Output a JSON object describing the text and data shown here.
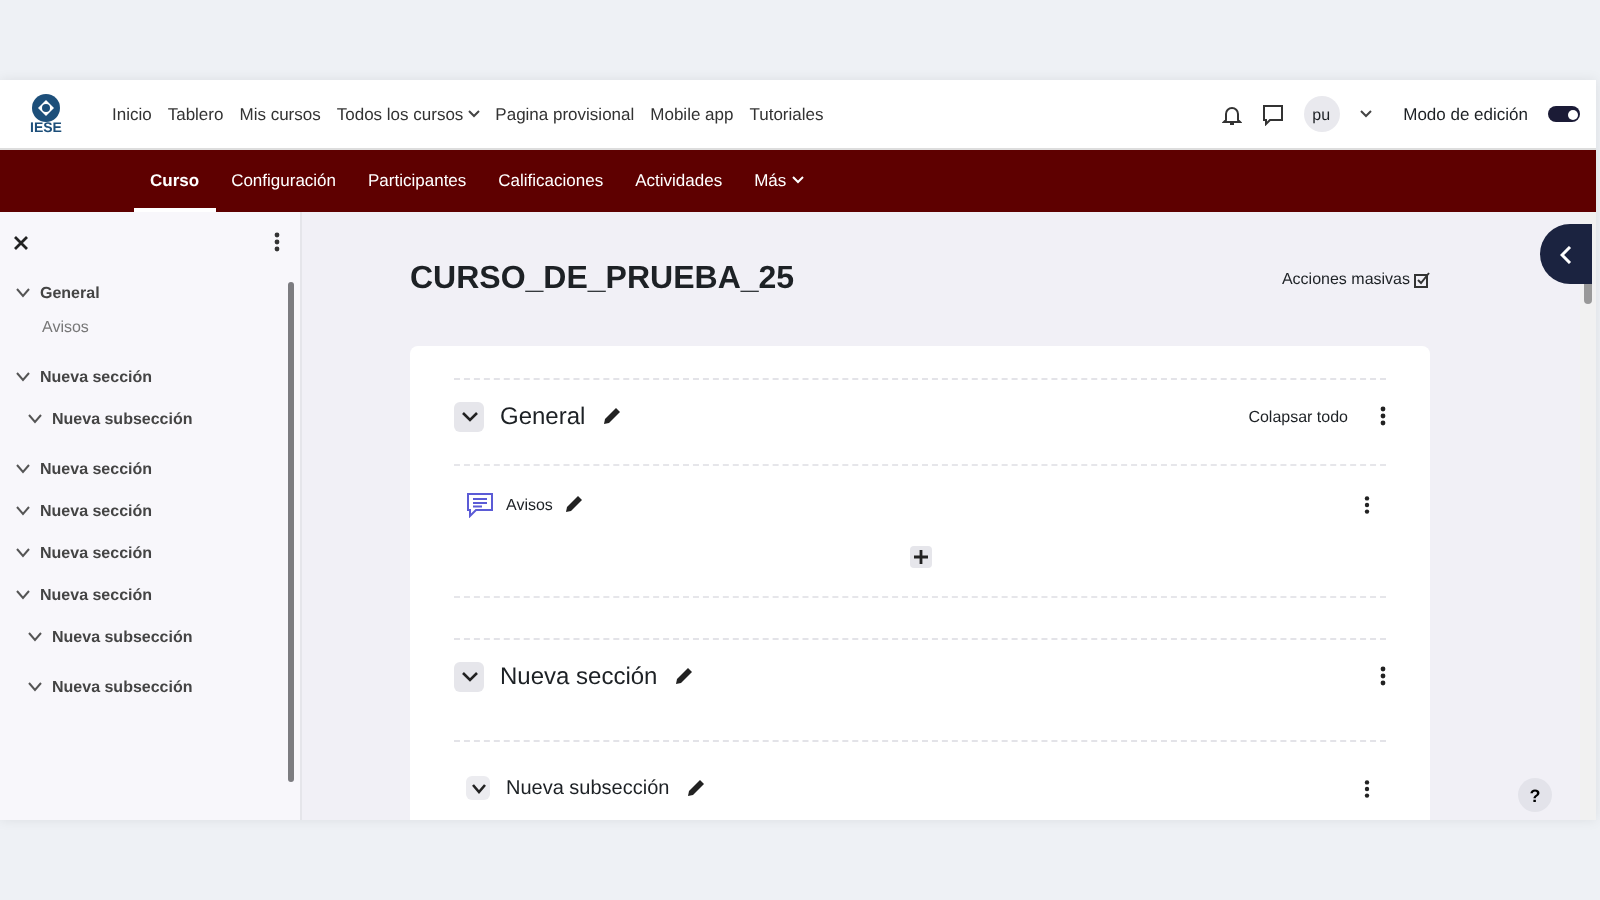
{
  "top_nav": {
    "logo_text": "IESE",
    "items": [
      {
        "label": "Inicio",
        "kind": "link"
      },
      {
        "label": "Tablero",
        "kind": "link"
      },
      {
        "label": "Mis cursos",
        "kind": "link"
      },
      {
        "label": "Todos los cursos",
        "kind": "dropdown"
      },
      {
        "label": "Pagina provisional",
        "kind": "link"
      },
      {
        "label": "Mobile app",
        "kind": "link"
      },
      {
        "label": "Tutoriales",
        "kind": "link"
      }
    ],
    "user_initials": "pu",
    "edit_mode": {
      "label": "Modo de edición",
      "on": true
    }
  },
  "course_tabs": [
    {
      "label": "Curso",
      "selected": true,
      "kind": "link"
    },
    {
      "label": "Configuración",
      "selected": false,
      "kind": "link"
    },
    {
      "label": "Participantes",
      "selected": false,
      "kind": "link"
    },
    {
      "label": "Calificaciones",
      "selected": false,
      "kind": "link"
    },
    {
      "label": "Actividades",
      "selected": false,
      "kind": "link"
    },
    {
      "label": "Más",
      "selected": false,
      "kind": "dropdown"
    }
  ],
  "sidebar": {
    "items": [
      {
        "label": "General",
        "expanded": true,
        "children": [
          {
            "label": "Avisos"
          }
        ]
      },
      {
        "label": "Nueva sección",
        "expanded": true,
        "children": [
          {
            "label": "Nueva subsección",
            "expanded": true
          }
        ]
      },
      {
        "label": "Nueva sección",
        "expanded": true
      },
      {
        "label": "Nueva sección",
        "expanded": true
      },
      {
        "label": "Nueva sección",
        "expanded": true
      },
      {
        "label": "Nueva sección",
        "expanded": true,
        "children": [
          {
            "label": "Nueva subsección",
            "expanded": true
          },
          {
            "label": "Nueva subsección",
            "expanded": true
          }
        ]
      }
    ]
  },
  "course": {
    "title": "CURSO_DE_PRUEBA_25",
    "bulk_actions": "Acciones masivas",
    "collapse_all": "Colapsar todo",
    "sections": [
      {
        "title": "General",
        "expanded": true,
        "activities": [
          {
            "label": "Avisos"
          }
        ]
      },
      {
        "title": "Nueva sección",
        "expanded": true,
        "subsections": [
          {
            "title": "Nueva subsección",
            "expanded": true
          }
        ]
      }
    ]
  },
  "help_button": "?"
}
